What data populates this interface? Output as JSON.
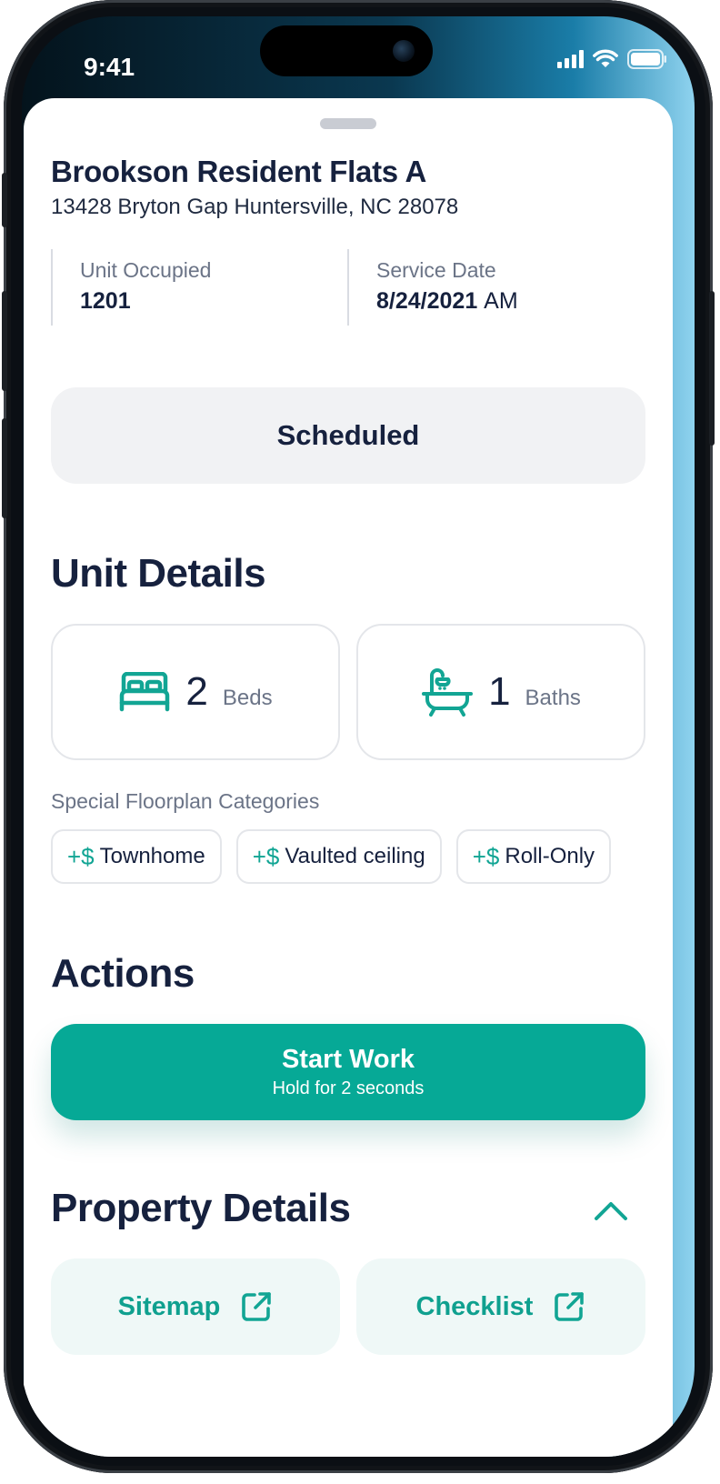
{
  "status_bar": {
    "time": "9:41",
    "icons": [
      "signal-icon",
      "wifi-icon",
      "battery-icon"
    ]
  },
  "property": {
    "name": "Brookson Resident Flats A",
    "address": "13428 Bryton Gap Huntersville, NC 28078"
  },
  "unit_occupied": {
    "label": "Unit Occupied",
    "value": "1201"
  },
  "service_date": {
    "label": "Service Date",
    "value": "8/24/2021",
    "suffix": "AM"
  },
  "status": "Scheduled",
  "unit_details": {
    "title": "Unit Details",
    "beds": {
      "count": "2",
      "unit": "Beds",
      "icon": "bed-icon"
    },
    "baths": {
      "count": "1",
      "unit": "Baths",
      "icon": "bathtub-icon"
    },
    "special_label": "Special Floorplan Categories",
    "categories": [
      {
        "prefix": "+$",
        "label": "Townhome"
      },
      {
        "prefix": "+$",
        "label": "Vaulted ceiling"
      },
      {
        "prefix": "+$",
        "label": "Roll-Only"
      }
    ]
  },
  "actions": {
    "title": "Actions",
    "start_work": {
      "label": "Start Work",
      "hint": "Hold for 2 seconds"
    }
  },
  "property_details": {
    "title": "Property Details",
    "toggle_icon": "chevron-up-icon",
    "links": [
      {
        "label": "Sitemap",
        "icon": "external-link-icon"
      },
      {
        "label": "Checklist",
        "icon": "external-link-icon"
      }
    ]
  },
  "colors": {
    "accent": "#06a996",
    "text": "#16213e",
    "muted": "#6b7487",
    "pill_bg": "#f1f2f4",
    "link_bg": "#eff8f7"
  }
}
